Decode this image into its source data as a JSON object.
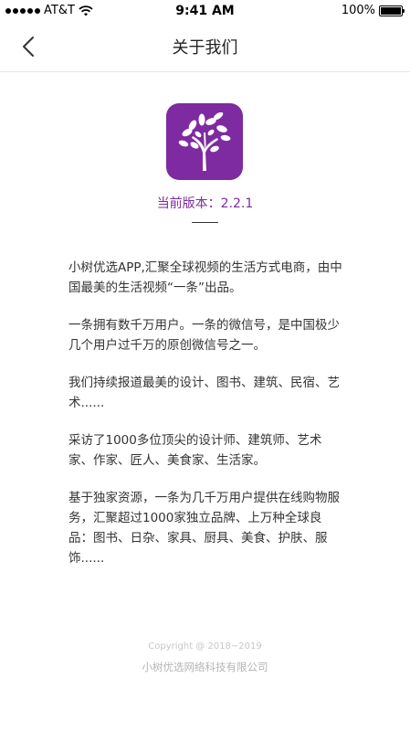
{
  "status_bar": {
    "carrier": "AT&T",
    "time": "9:41 AM",
    "battery": "100%"
  },
  "nav": {
    "title": "关于我们"
  },
  "app": {
    "icon_name": "tree-icon",
    "brand_color": "#7e2aa0",
    "version_text": "当前版本：2.2.1"
  },
  "content": {
    "paragraphs": [
      "小树优选APP,汇聚全球视频的生活方式电商，由中国最美的生活视频“一条”出品。",
      "一条拥有数千万用户。一条的微信号，是中国极少几个用户过千万的原创微信号之一。",
      "我们持续报道最美的设计、图书、建筑、民宿、艺术......",
      "采访了1000多位顶尖的设计师、建筑师、艺术家、作家、匠人、美食家、生活家。",
      "基于独家资源，一条为几千万用户提供在线购物服务，汇聚超过1000家独立品牌、上万种全球良品：图书、日杂、家具、厨具、美食、护肤、服饰......"
    ]
  },
  "footer": {
    "copyright": "Copyright @ 2018~2019",
    "company": "小树优选网络科技有限公司"
  }
}
